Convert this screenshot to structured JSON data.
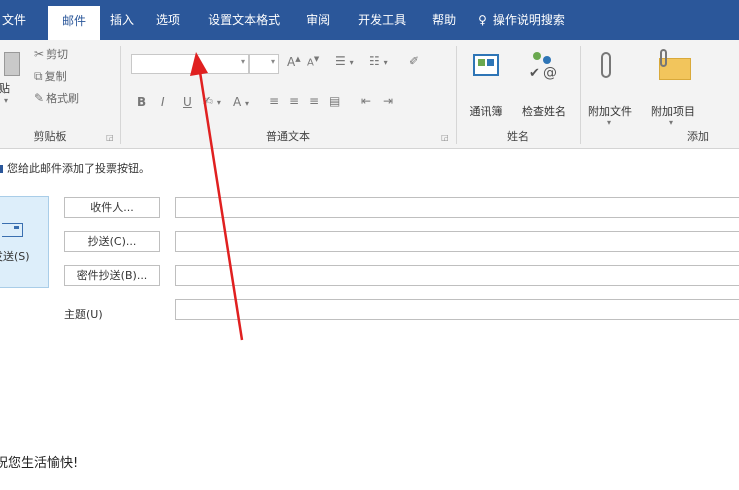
{
  "tabs": [
    {
      "label": "文件",
      "active": false
    },
    {
      "label": "邮件",
      "active": true
    },
    {
      "label": "插入",
      "active": false
    },
    {
      "label": "选项",
      "active": false
    },
    {
      "label": "设置文本格式",
      "active": false
    },
    {
      "label": "审阅",
      "active": false
    },
    {
      "label": "开发工具",
      "active": false
    },
    {
      "label": "帮助",
      "active": false
    }
  ],
  "tell_me": {
    "icon": "lightbulb-icon",
    "label": "操作说明搜索"
  },
  "ribbon": {
    "clipboard": {
      "group_label": "剪贴板",
      "paste_label": "粘贴",
      "cut_label": "剪切",
      "copy_label": "复制",
      "format_painter_label": "格式刷"
    },
    "basic_text": {
      "group_label": "普通文本",
      "bold": "B",
      "italic": "I",
      "underline": "U",
      "font_grow": "A",
      "font_shrink": "A",
      "font_color": "A"
    },
    "names": {
      "group_label": "姓名",
      "address_book_label": "通讯簿",
      "check_names_label": "检查姓名"
    },
    "include": {
      "group_label": "添加",
      "attach_file_label": "附加文件",
      "attach_item_label": "附加项目"
    }
  },
  "info_bar": {
    "text": "您给此邮件添加了投票按钮。"
  },
  "compose": {
    "send_label": "发送(S)",
    "to_label": "收件人...",
    "cc_label": "抄送(C)...",
    "bcc_label": "密件抄送(B)...",
    "subject_label": "主题(U)",
    "to_value": "",
    "cc_value": "",
    "bcc_value": "",
    "subject_value": "",
    "body_text": "祝您生活愉快!"
  },
  "colors": {
    "ribbon_blue": "#2b579a",
    "ribbon_bg": "#f3f3f3",
    "send_bg": "#ddeefa",
    "arrow_red": "#e02020"
  }
}
